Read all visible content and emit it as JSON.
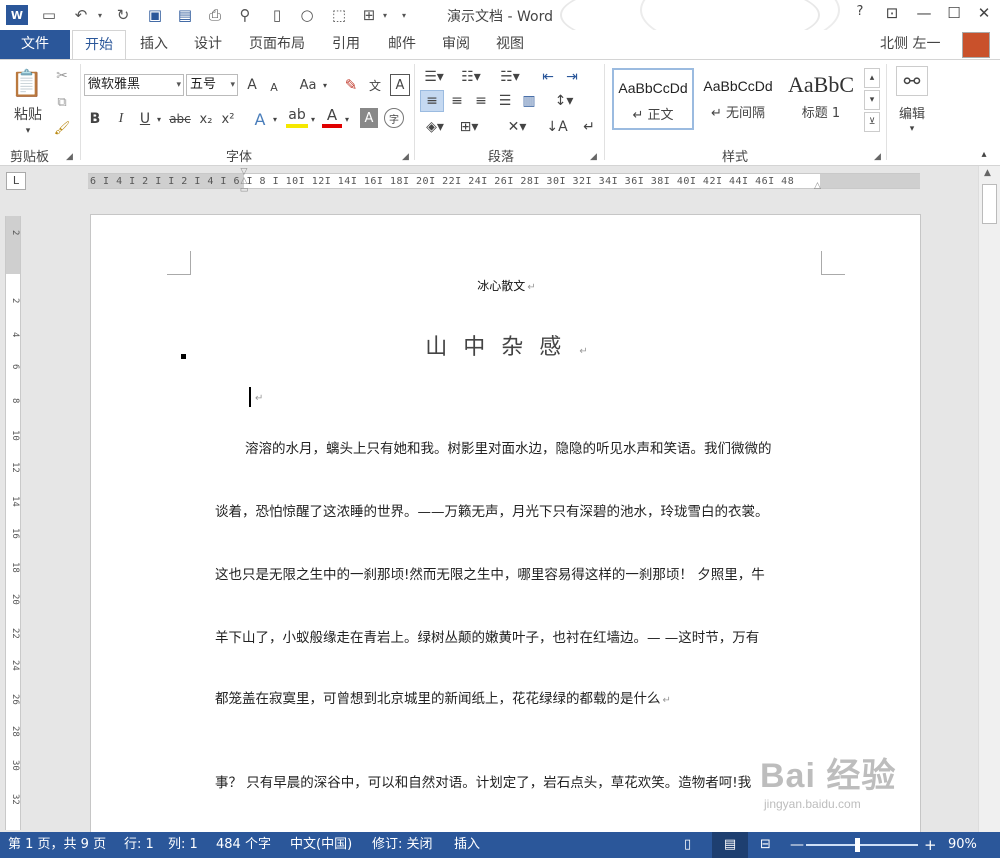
{
  "window": {
    "title": "演示文档 - Word",
    "help_label": "?",
    "user_name": "北侧 左一"
  },
  "ribbon_tabs": [
    {
      "label": "文件"
    },
    {
      "label": "开始"
    },
    {
      "label": "插入"
    },
    {
      "label": "设计"
    },
    {
      "label": "页面布局"
    },
    {
      "label": "引用"
    },
    {
      "label": "邮件"
    },
    {
      "label": "审阅"
    },
    {
      "label": "视图"
    }
  ],
  "clipboard": {
    "paste_label": "粘贴",
    "group_label": "剪贴板"
  },
  "font": {
    "font_name": "微软雅黑",
    "font_size": "五号",
    "grow_label": "A",
    "shrink_label": "A",
    "case_label": "Aa",
    "phonetic_label": "文",
    "border_label": "A",
    "bold_label": "B",
    "italic_label": "I",
    "underline_label": "U",
    "strike_label": "abc",
    "sub_label": "x₂",
    "sup_label": "x²",
    "effect_label": "A",
    "color_label": "A",
    "shade_label": "A",
    "enclose_label": "字",
    "group_label": "字体"
  },
  "paragraph": {
    "group_label": "段落"
  },
  "styles": {
    "items": [
      {
        "sample": "AaBbCcDd",
        "name": "↵ 正文"
      },
      {
        "sample": "AaBbCcDd",
        "name": "↵ 无间隔"
      },
      {
        "sample": "AaBbC",
        "name": "标题 1"
      }
    ],
    "group_label": "样式"
  },
  "editing": {
    "label": "编辑"
  },
  "ruler": {
    "tab_selector": "L",
    "text": "6 I  4 I  2 I  I  2 I  4 I  6 I  8 I  10I  12I  14I  16I  18I  20I  22I  24I  26I  28I  30I  32I  34I  36I  38I  40I  42I  44I  46I  48",
    "vertical_numbers": [
      "2",
      "2",
      "4",
      "6",
      "8",
      "10",
      "12",
      "14",
      "16",
      "18",
      "20",
      "22",
      "24",
      "26",
      "28",
      "30",
      "32"
    ]
  },
  "document": {
    "header": "冰心散文",
    "heading": "山中杂感",
    "lines": [
      "溶溶的水月，螭头上只有她和我。树影里对面水边，隐隐的听见水声和笑语。我们微微的",
      "谈着，恐怕惊醒了这浓睡的世界。——万籁无声，月光下只有深碧的池水，玲珑雪白的衣裳。",
      "这也只是无限之生中的一刹那顷!然而无限之生中，哪里容易得这样的一刹那顷！ 夕照里，牛",
      "羊下山了，小蚁般缘走在青岩上。绿树丛颠的嫩黄叶子，也衬在红墙边。— —这时节，万有",
      "都笼盖在寂寞里，可曾想到北京城里的新闻纸上，花花绿绿的都载的是什么",
      "事？ 只有早晨的深谷中，可以和自然对语。计划定了，岩石点头，草花欢笑。造物者呵!我"
    ],
    "paragraph_mark": "↵"
  },
  "status": {
    "page": "第 1 页，共 9 页",
    "row": "行: 1",
    "col": "列: 1",
    "words": "484 个字",
    "language": "中文(中国)",
    "track": "修订: 关闭",
    "insert_mode": "插入",
    "zoom": "90%",
    "zoom_fraction": 0.46
  },
  "watermark": {
    "logo": "Bai 经验",
    "url": "jingyan.baidu.com"
  },
  "colors": {
    "accent": "#2b579a",
    "page": "#ffffff",
    "canvas": "#e6e6e6"
  }
}
